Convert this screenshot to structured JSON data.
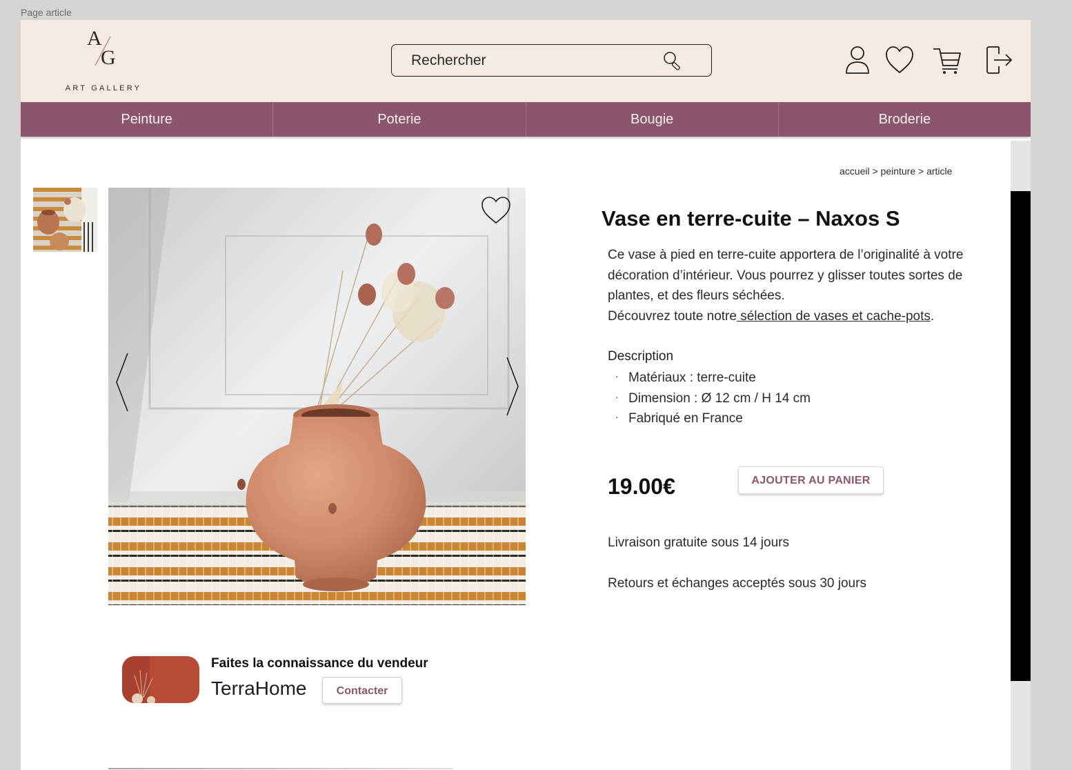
{
  "frame_label": "Page article",
  "header": {
    "logo_mark": "A/G",
    "logo_sub": "ART GALLERY",
    "search_placeholder": "Rechercher",
    "icons": [
      "user-icon",
      "heart-icon",
      "cart-icon",
      "logout-icon"
    ]
  },
  "nav": {
    "items": [
      {
        "label": "Peinture"
      },
      {
        "label": "Poterie"
      },
      {
        "label": "Bougie"
      },
      {
        "label": "Broderie"
      }
    ]
  },
  "breadcrumb": "accueil > peinture > article",
  "product": {
    "title": "Vase en terre-cuite – Naxos S",
    "intro_text": "Ce vase à pied en terre-cuite apportera de l’originalité à votre décoration d’intérieur. Vous pourrez y glisser toutes sortes de plantes, et des fleurs séchées.",
    "discover_prefix": "Découvrez toute notre",
    "discover_link": " sélection de vases et cache-pots",
    "discover_suffix": ".",
    "description_heading": "Description",
    "description_items": [
      "Matériaux : terre-cuite",
      "Dimension : Ø 12 cm / H 14 cm",
      "Fabriqué en France"
    ],
    "price": "19.00€",
    "add_to_cart": "AJOUTER AU PANIER",
    "shipping": "Livraison gratuite sous 14 jours",
    "returns": "Retours et échanges acceptés sous 30 jours"
  },
  "seller": {
    "heading": "Faites la connaissance du vendeur",
    "name": "TerraHome",
    "contact_label": "Contacter"
  },
  "colors": {
    "header_bg": "#f5ebe2",
    "nav_bg": "#8b566d",
    "accent": "#8b566d",
    "page_bg": "#ffffff",
    "backdrop": "#d6d3d3"
  }
}
